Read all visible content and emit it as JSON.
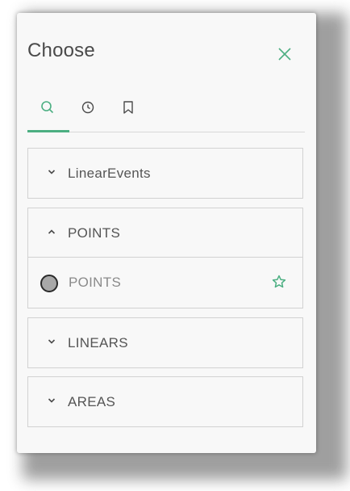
{
  "panel": {
    "title": "Choose",
    "close_icon": "close-icon"
  },
  "tabs": [
    {
      "icon": "search-icon",
      "active": true
    },
    {
      "icon": "clock-icon",
      "active": false
    },
    {
      "icon": "bookmark-icon",
      "active": false
    }
  ],
  "groups": [
    {
      "label": "LinearEvents",
      "expanded": false
    },
    {
      "label": "POINTS",
      "expanded": true,
      "items": [
        {
          "label": "POINTS",
          "symbol": "gray-circle-symbol",
          "favorite_icon": "star-icon"
        }
      ]
    },
    {
      "label": "LINEARS",
      "expanded": false
    },
    {
      "label": "AREAS",
      "expanded": false
    }
  ],
  "colors": {
    "accent": "#4caf82",
    "text": "#555555",
    "muted_text": "#8a8a8a",
    "border": "#d2d2d2"
  }
}
